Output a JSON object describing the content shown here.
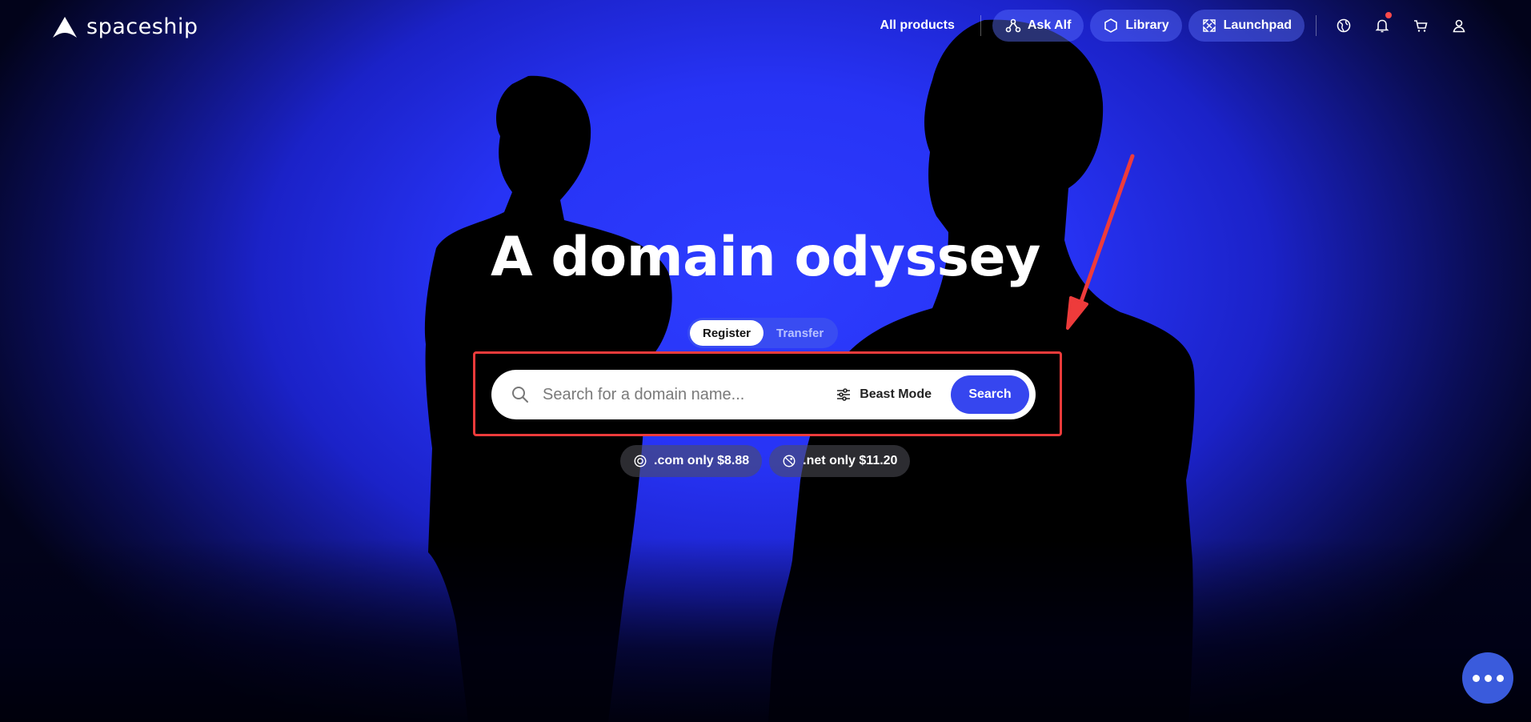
{
  "brand": {
    "name": "spaceship"
  },
  "nav": {
    "all_products": "All products",
    "ask_alf": "Ask Alf",
    "library": "Library",
    "launchpad": "Launchpad"
  },
  "hero": {
    "title": "A domain odyssey",
    "tabs": [
      {
        "label": "Register",
        "active": true
      },
      {
        "label": "Transfer",
        "active": false
      }
    ],
    "search": {
      "placeholder": "Search for a domain name...",
      "value": "",
      "beast_mode_label": "Beast Mode",
      "button_label": "Search"
    },
    "promos": [
      {
        "label": ".com only $8.88",
        "icon": "com-target-icon"
      },
      {
        "label": ".net only $11.20",
        "icon": "net-orbit-icon"
      }
    ]
  },
  "annotation": {
    "highlight_color": "#ee3b3b",
    "arrow_color": "#ee3b3b"
  },
  "colors": {
    "accent": "#3646ef",
    "background": "#2733f5",
    "notification": "#ff4a4a"
  }
}
